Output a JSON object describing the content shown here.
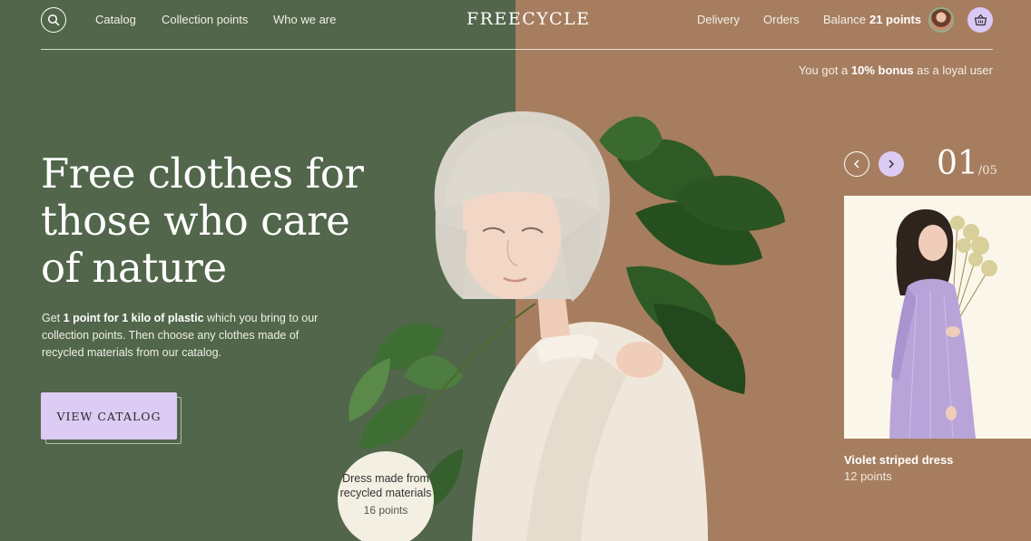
{
  "brand": {
    "logo": "FREECYCLE"
  },
  "nav": {
    "left_links": [
      "Catalog",
      "Collection points",
      "Who we are"
    ],
    "right_links": [
      "Delivery",
      "Orders"
    ],
    "balance_label": "Balance",
    "balance_value": "21 points"
  },
  "bonus": {
    "prefix": "You got a",
    "highlight": "10% bonus",
    "suffix": "as a loyal user"
  },
  "hero": {
    "title": "Free clothes for those who care of nature",
    "desc_prefix": "Get",
    "desc_highlight": "1 point for 1 kilo of plastic",
    "desc_suffix": "which you bring to our collection points. Then choose any clothes made of recycled materials from our catalog.",
    "cta": "VIEW CATALOG"
  },
  "badge": {
    "title": "Dress made from recycled materials",
    "points": "16 points"
  },
  "slider": {
    "current": "01",
    "total": "/05"
  },
  "product": {
    "name": "Violet striped dress",
    "points": "12 points"
  },
  "colors": {
    "left_bg": "#51664a",
    "right_bg": "#a67e5f",
    "accent": "#dccbf3",
    "card_bg": "#fbf6ea"
  },
  "icons": [
    "search-icon",
    "avatar",
    "basket-icon",
    "chevron-left-icon",
    "chevron-right-icon"
  ]
}
